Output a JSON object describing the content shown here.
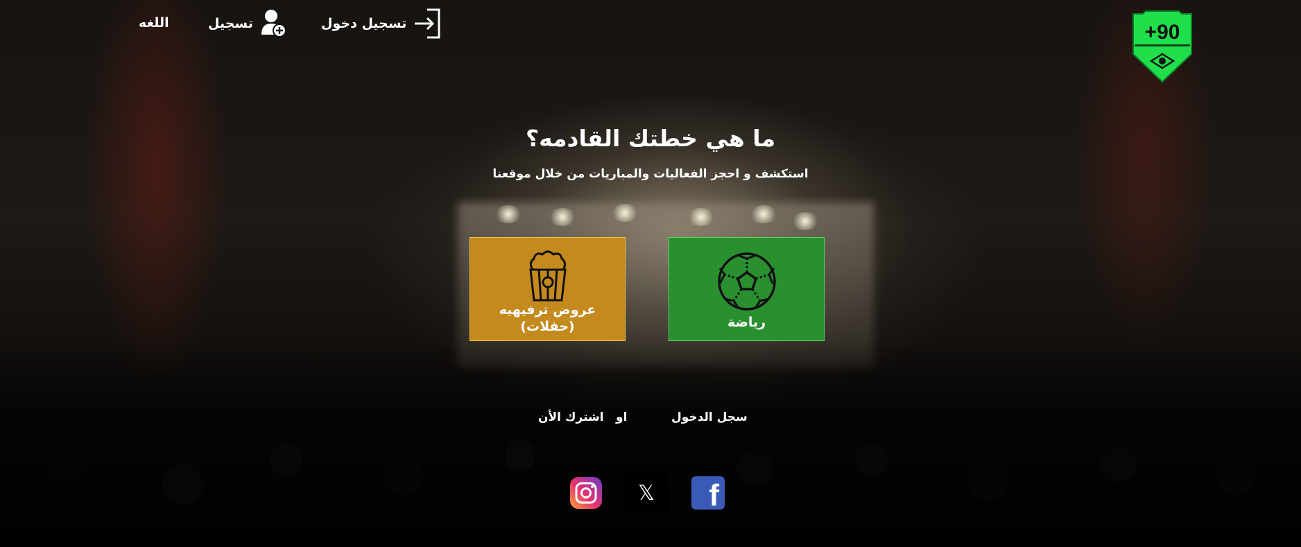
{
  "header": {
    "language_label": "اللغه",
    "register_label": "تسجيل",
    "login_label": "تسجيل دخول",
    "logo_text": "+90"
  },
  "hero": {
    "title": "ما هي خطتك القادمه؟",
    "subtitle": "استكشف و احجز الفعاليات والمباريات من خلال موقعنا"
  },
  "categories": [
    {
      "label": "رياضة",
      "icon": "soccer-ball-icon",
      "color": "#2a902f"
    },
    {
      "label": "عروض ترفيهيه (حفلات)",
      "icon": "popcorn-icon",
      "color": "#c48a1e"
    }
  ],
  "cta": {
    "login_link": "سجل الدخول",
    "or_text": "او",
    "signup_link": "اشترك الأن"
  },
  "social": [
    {
      "name": "instagram-icon"
    },
    {
      "name": "x-icon",
      "glyph": "𝕏"
    },
    {
      "name": "facebook-icon",
      "glyph": "f"
    }
  ],
  "colors": {
    "brand_green": "#1fe04a",
    "sports_card": "#2a902f",
    "entertainment_card": "#c48a1e",
    "facebook": "#3b5ab8"
  }
}
